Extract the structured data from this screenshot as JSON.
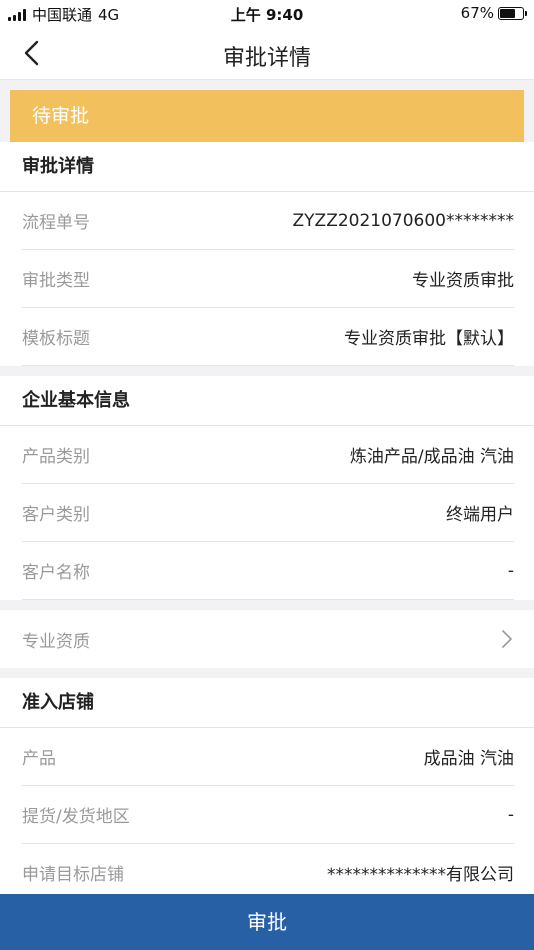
{
  "status_bar": {
    "carrier": "中国联通",
    "network": "4G",
    "time": "上午 9:40",
    "battery": "67%",
    "battery_level": 0.67
  },
  "nav": {
    "title": "审批详情",
    "back_icon": "chevron-left-icon"
  },
  "status_banner": "待审批",
  "approval_section": {
    "heading": "审批详情",
    "rows": [
      {
        "label": "流程单号",
        "value": "ZYZZ2021070600********"
      },
      {
        "label": "审批类型",
        "value": "专业资质审批"
      },
      {
        "label": "模板标题",
        "value": "专业资质审批【默认】"
      }
    ]
  },
  "company_section": {
    "heading": "企业基本信息",
    "rows": [
      {
        "label": "产品类别",
        "value": "炼油产品/成品油 汽油"
      },
      {
        "label": "客户类别",
        "value": "终端用户"
      },
      {
        "label": "客户名称",
        "value": "-"
      }
    ]
  },
  "qualification_link": {
    "label": "专业资质",
    "icon": "chevron-right-icon"
  },
  "store_section": {
    "heading": "准入店铺",
    "rows": [
      {
        "label": "产品",
        "value": "成品油 汽油"
      },
      {
        "label": "提货/发货地区",
        "value": "-"
      },
      {
        "label": "申请目标店铺",
        "value": "**************有限公司"
      }
    ]
  },
  "bottom_button": "审批",
  "colors": {
    "banner": "#f2c15e",
    "primary": "#2860a6"
  }
}
